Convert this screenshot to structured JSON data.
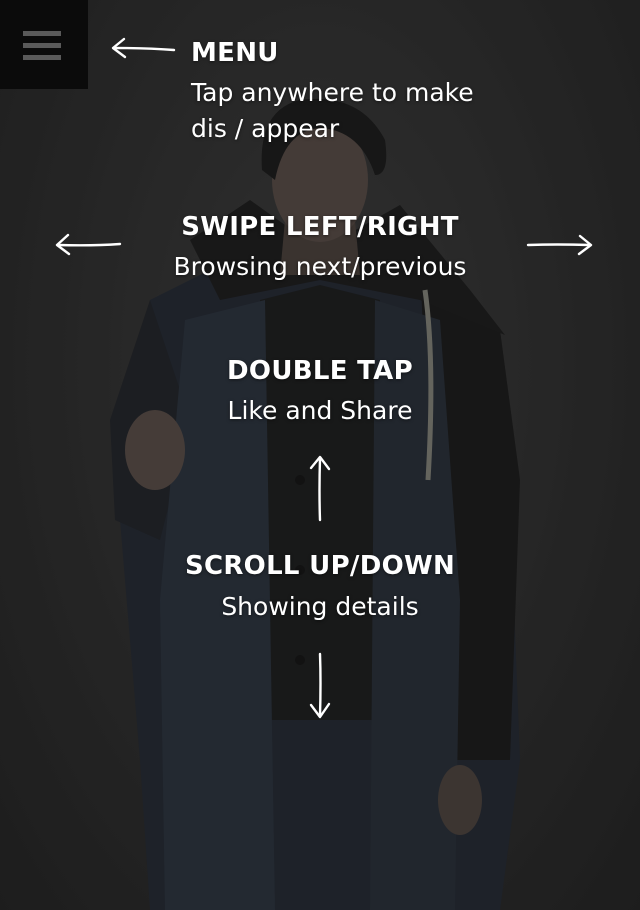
{
  "menu": {
    "icon": "hamburger-menu-icon",
    "heading": "MENU",
    "text_line1": "Tap anywhere to make",
    "text_line2": "dis / appear"
  },
  "swipe": {
    "heading": "SWIPE LEFT/RIGHT",
    "text": "Browsing next/previous"
  },
  "double_tap": {
    "heading": "DOUBLE TAP",
    "text": "Like and Share"
  },
  "scroll": {
    "heading": "SCROLL UP/DOWN",
    "text": "Showing details"
  },
  "icons": [
    "hamburger-menu-icon",
    "arrow-left-icon",
    "arrow-right-icon",
    "arrow-up-icon",
    "arrow-down-icon"
  ],
  "colors": {
    "overlay_text": "#ffffff",
    "menu_button_bg": "#0b0b0b",
    "menu_bars": "#5a5a5a",
    "background": "#2a2a2a"
  }
}
